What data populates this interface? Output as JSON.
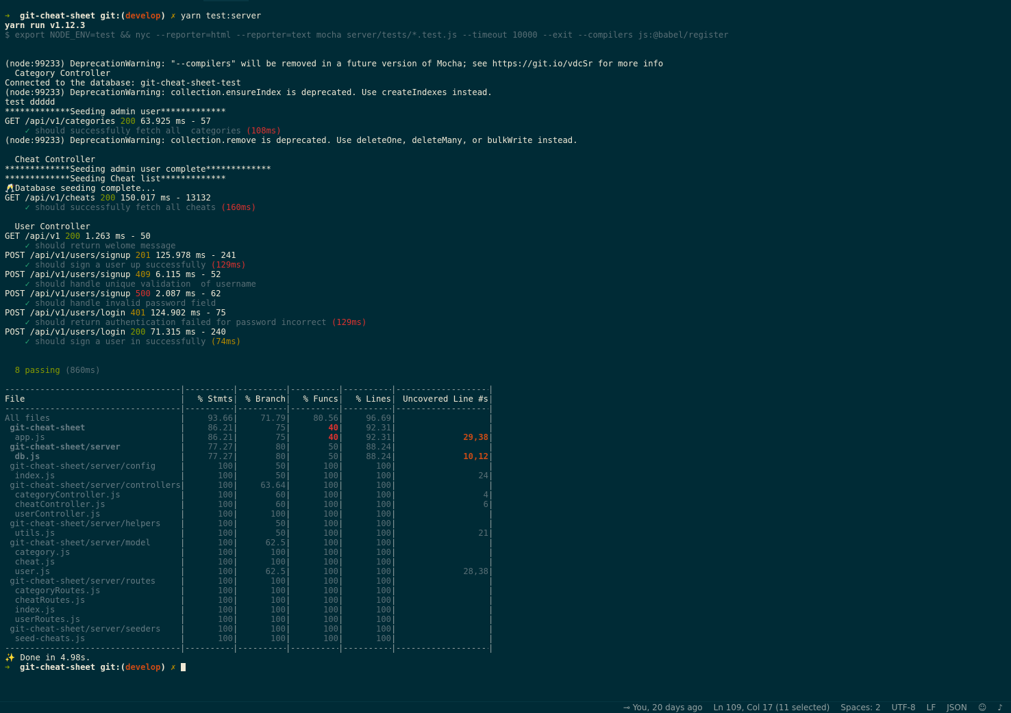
{
  "terminal": {
    "cmd": {
      "prompt_arrow": "➜",
      "dir": "git-cheat-sheet",
      "git_prefix": "git:(",
      "branch": "develop",
      "git_suffix": ")",
      "dirty": "✗",
      "command": "yarn test:server"
    },
    "yarn_version": "yarn run v1.12.3",
    "run_line": "$ export NODE_ENV=test && nyc --reporter=html --reporter=text mocha server/tests/*.test.js --timeout 10000 --exit --compilers js:@babel/register",
    "warn1": "(node:99233) DeprecationWarning: \"--compilers\" will be removed in a future version of Mocha; see https://git.io/vdcSr for more info",
    "suite1": "  Category Controller",
    "db_connected": "Connected to the database: git-cheat-sheet-test",
    "warn2": "(node:99233) DeprecationWarning: collection.ensureIndex is deprecated. Use createIndexes instead.",
    "test_line": "test ddddd",
    "seed_admin": "*************Seeding admin user*************",
    "req1": {
      "method": "GET /api/v1/categories ",
      "status": "200",
      "rest": " 63.925 ms - 57"
    },
    "pass1": {
      "text": "should successfully fetch all  categories ",
      "time": "(108ms)"
    },
    "warn3": "(node:99233) DeprecationWarning: collection.remove is deprecated. Use deleteOne, deleteMany, or bulkWrite instead.",
    "suite2": "  Cheat Controller",
    "seed_admin_done": "*************Seeding admin user complete*************",
    "seed_cheat": "*************Seeding Cheat list*************",
    "db_seed_done": "🥂Database seeding complete...",
    "req2": {
      "method": "GET /api/v1/cheats ",
      "status": "200",
      "rest": " 150.017 ms - 13132"
    },
    "pass2": {
      "text": "should successfully fetch all cheats ",
      "time": "(160ms)"
    },
    "suite3": "  User Controller",
    "req3": {
      "method": "GET /api/v1 ",
      "status": "200",
      "rest": " 1.263 ms - 50"
    },
    "pass3": {
      "text": "should return welome message",
      "time": ""
    },
    "req4": {
      "method": "POST /api/v1/users/signup ",
      "status": "201",
      "rest": " 125.978 ms - 241"
    },
    "pass4": {
      "text": "should sign a user up successfully ",
      "time": "(129ms)"
    },
    "req5": {
      "method": "POST /api/v1/users/signup ",
      "status": "409",
      "rest": " 6.115 ms - 52"
    },
    "pass5": {
      "text": "should handle unique validation  of username",
      "time": ""
    },
    "req6": {
      "method": "POST /api/v1/users/signup ",
      "status": "500",
      "rest": " 2.087 ms - 62"
    },
    "pass6": {
      "text": "should handle invalid password field",
      "time": ""
    },
    "req7": {
      "method": "POST /api/v1/users/login ",
      "status": "401",
      "rest": " 124.902 ms - 75"
    },
    "pass7": {
      "text": "should return authentication failed for password incorrect ",
      "time": "(129ms)"
    },
    "req8": {
      "method": "POST /api/v1/users/login ",
      "status": "200",
      "rest": " 71.315 ms - 240"
    },
    "pass8": {
      "text": "should sign a user in successfully ",
      "time": "(74ms)"
    },
    "passing": "8 passing",
    "passing_time": " (860ms)",
    "check": "✓",
    "done": "✨ Done in 4.98s.",
    "colors": {
      "green": "#859900",
      "yellow": "#b58900",
      "red": "#dc322f",
      "orange": "#cb4b16",
      "background": "#002b36"
    }
  },
  "coverage": {
    "headers": [
      "File",
      "% Stmts",
      "% Branch",
      "% Funcs",
      "% Lines",
      "Uncovered Line #s"
    ],
    "rows": [
      {
        "file": "All files",
        "stmts": "93.66",
        "branch": "71.79",
        "funcs": "80.56",
        "lines": "96.69",
        "uncovered": "",
        "dir": false
      },
      {
        "file": " git-cheat-sheet",
        "stmts": "86.21",
        "branch": "75",
        "funcs": "40",
        "lines": "92.31",
        "uncovered": "",
        "dir": true,
        "funcs_low": true
      },
      {
        "file": "  app.js",
        "stmts": "86.21",
        "branch": "75",
        "funcs": "40",
        "lines": "92.31",
        "uncovered": "29,38",
        "dir": false,
        "funcs_low": true,
        "unc_hi": true
      },
      {
        "file": " git-cheat-sheet/server",
        "stmts": "77.27",
        "branch": "80",
        "funcs": "50",
        "lines": "88.24",
        "uncovered": "",
        "dir": true
      },
      {
        "file": "  db.js",
        "stmts": "77.27",
        "branch": "80",
        "funcs": "50",
        "lines": "88.24",
        "uncovered": "10,12",
        "dir": true,
        "unc_hi": true
      },
      {
        "file": " git-cheat-sheet/server/config",
        "stmts": "100",
        "branch": "50",
        "funcs": "100",
        "lines": "100",
        "uncovered": "",
        "dir": false
      },
      {
        "file": "  index.js",
        "stmts": "100",
        "branch": "50",
        "funcs": "100",
        "lines": "100",
        "uncovered": "24",
        "dir": false
      },
      {
        "file": " git-cheat-sheet/server/controllers",
        "stmts": "100",
        "branch": "63.64",
        "funcs": "100",
        "lines": "100",
        "uncovered": "",
        "dir": false
      },
      {
        "file": "  categoryController.js",
        "stmts": "100",
        "branch": "60",
        "funcs": "100",
        "lines": "100",
        "uncovered": "4",
        "dir": false
      },
      {
        "file": "  cheatController.js",
        "stmts": "100",
        "branch": "60",
        "funcs": "100",
        "lines": "100",
        "uncovered": "6",
        "dir": false
      },
      {
        "file": "  userController.js",
        "stmts": "100",
        "branch": "100",
        "funcs": "100",
        "lines": "100",
        "uncovered": "",
        "dir": false
      },
      {
        "file": " git-cheat-sheet/server/helpers",
        "stmts": "100",
        "branch": "50",
        "funcs": "100",
        "lines": "100",
        "uncovered": "",
        "dir": false
      },
      {
        "file": "  utils.js",
        "stmts": "100",
        "branch": "50",
        "funcs": "100",
        "lines": "100",
        "uncovered": "21",
        "dir": false
      },
      {
        "file": " git-cheat-sheet/server/model",
        "stmts": "100",
        "branch": "62.5",
        "funcs": "100",
        "lines": "100",
        "uncovered": "",
        "dir": false
      },
      {
        "file": "  category.js",
        "stmts": "100",
        "branch": "100",
        "funcs": "100",
        "lines": "100",
        "uncovered": "",
        "dir": false
      },
      {
        "file": "  cheat.js",
        "stmts": "100",
        "branch": "100",
        "funcs": "100",
        "lines": "100",
        "uncovered": "",
        "dir": false
      },
      {
        "file": "  user.js",
        "stmts": "100",
        "branch": "62.5",
        "funcs": "100",
        "lines": "100",
        "uncovered": "28,38",
        "dir": false
      },
      {
        "file": " git-cheat-sheet/server/routes",
        "stmts": "100",
        "branch": "100",
        "funcs": "100",
        "lines": "100",
        "uncovered": "",
        "dir": false
      },
      {
        "file": "  categoryRoutes.js",
        "stmts": "100",
        "branch": "100",
        "funcs": "100",
        "lines": "100",
        "uncovered": "",
        "dir": false
      },
      {
        "file": "  cheatRoutes.js",
        "stmts": "100",
        "branch": "100",
        "funcs": "100",
        "lines": "100",
        "uncovered": "",
        "dir": false
      },
      {
        "file": "  index.js",
        "stmts": "100",
        "branch": "100",
        "funcs": "100",
        "lines": "100",
        "uncovered": "",
        "dir": false
      },
      {
        "file": "  userRoutes.js",
        "stmts": "100",
        "branch": "100",
        "funcs": "100",
        "lines": "100",
        "uncovered": "",
        "dir": false
      },
      {
        "file": " git-cheat-sheet/server/seeders",
        "stmts": "100",
        "branch": "100",
        "funcs": "100",
        "lines": "100",
        "uncovered": "",
        "dir": false
      },
      {
        "file": "  seed-cheats.js",
        "stmts": "100",
        "branch": "100",
        "funcs": "100",
        "lines": "100",
        "uncovered": "",
        "dir": false
      }
    ]
  },
  "statusbar": {
    "git_blame": "You, 20 days ago",
    "git_icon": "git-commit-icon",
    "position": "Ln 109, Col 17 (11 selected)",
    "spaces": "Spaces: 2",
    "encoding": "UTF-8",
    "eol": "LF",
    "language": "JSON",
    "feedback_icon": "smiley-icon",
    "bell_icon": "bell-icon"
  }
}
